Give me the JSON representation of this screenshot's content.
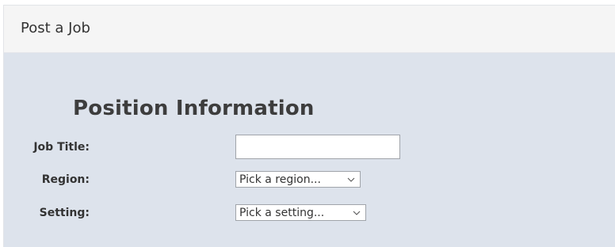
{
  "header": {
    "title": "Post a Job"
  },
  "form": {
    "section_title": "Position Information",
    "job_title": {
      "label": "Job Title:",
      "value": "",
      "placeholder": ""
    },
    "region": {
      "label": "Region:",
      "selected": "Pick a region..."
    },
    "setting": {
      "label": "Setting:",
      "selected": "Pick a setting..."
    }
  },
  "colors": {
    "header_bg": "#f5f5f5",
    "body_bg": "#dde3ec",
    "input_border": "#a0a4aa"
  },
  "icons": {
    "dropdown": "chevron-down-icon"
  }
}
